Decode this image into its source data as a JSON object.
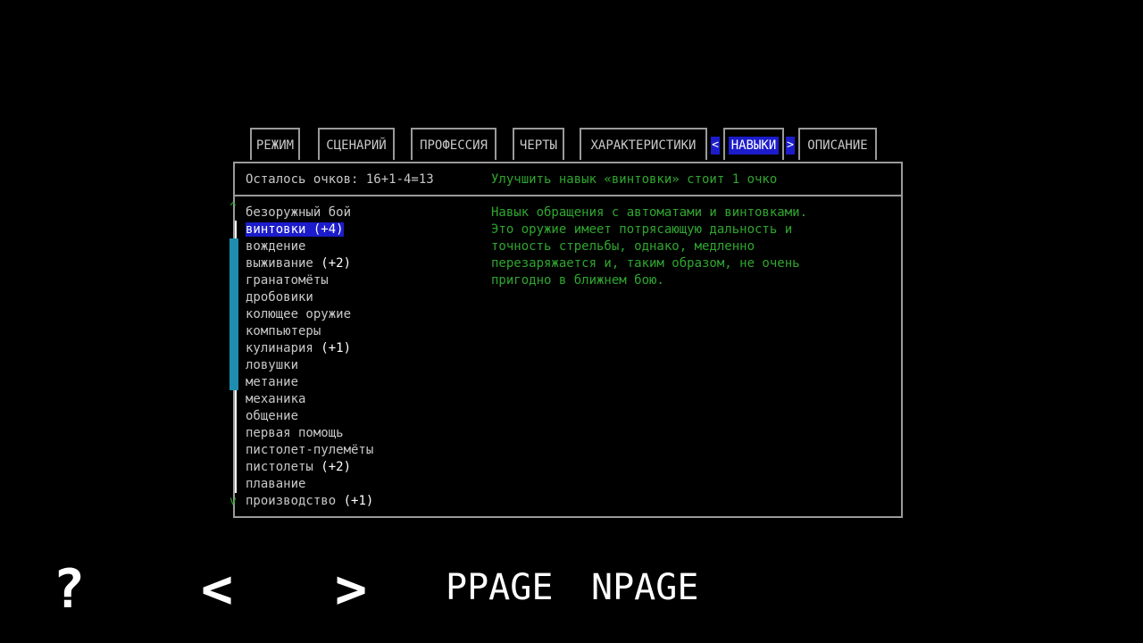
{
  "tabs": [
    {
      "label": "РЕЖИМ",
      "active": false
    },
    {
      "label": "СЦЕНАРИЙ",
      "active": false
    },
    {
      "label": "ПРОФЕССИЯ",
      "active": false
    },
    {
      "label": "ЧЕРТЫ",
      "active": false
    },
    {
      "label": "ХАРАКТЕРИСТИКИ",
      "active": false
    },
    {
      "label": "НАВЫКИ",
      "active": true
    },
    {
      "label": "ОПИСАНИЕ",
      "active": false
    }
  ],
  "tab_arrows": {
    "left": "<",
    "right": ">"
  },
  "header": {
    "points": "Осталось очков: 16+1-4=13",
    "upgrade_hint": "Улучшить навык «винтовки» стоит 1 очко"
  },
  "scroll": {
    "up": "^",
    "down": "v"
  },
  "skills": [
    {
      "name": "безоружный бой",
      "bonus": "",
      "selected": false
    },
    {
      "name": "винтовки",
      "bonus": "(+4)",
      "selected": true
    },
    {
      "name": "вождение",
      "bonus": "",
      "selected": false
    },
    {
      "name": "выживание",
      "bonus": "(+2)",
      "selected": false
    },
    {
      "name": "гранатомёты",
      "bonus": "",
      "selected": false
    },
    {
      "name": "дробовики",
      "bonus": "",
      "selected": false
    },
    {
      "name": "колющее оружие",
      "bonus": "",
      "selected": false
    },
    {
      "name": "компьютеры",
      "bonus": "",
      "selected": false
    },
    {
      "name": "кулинария",
      "bonus": "(+1)",
      "selected": false
    },
    {
      "name": "ловушки",
      "bonus": "",
      "selected": false
    },
    {
      "name": "метание",
      "bonus": "",
      "selected": false
    },
    {
      "name": "механика",
      "bonus": "",
      "selected": false
    },
    {
      "name": "общение",
      "bonus": "",
      "selected": false
    },
    {
      "name": "первая помощь",
      "bonus": "",
      "selected": false
    },
    {
      "name": "пистолет-пулемёты",
      "bonus": "",
      "selected": false
    },
    {
      "name": "пистолеты",
      "bonus": "(+2)",
      "selected": false
    },
    {
      "name": "плавание",
      "bonus": "",
      "selected": false
    },
    {
      "name": "производство",
      "bonus": "(+1)",
      "selected": false
    }
  ],
  "description": [
    "Навык обращения с автоматами и винтовками.",
    "Это оружие имеет потрясающую дальность и",
    "точность стрельбы, однако, медленно",
    "перезаряжается и, таким образом, не очень",
    "пригодно в ближнем бою."
  ],
  "buttons": {
    "help": "?",
    "prev": "<",
    "next": ">",
    "ppage": "PPAGE",
    "npage": "NPAGE"
  },
  "colors": {
    "highlight": "#1c1ccc",
    "hint_green": "#2fa62f",
    "scroll_thumb": "#1e8db0",
    "border": "#9a9a9a"
  }
}
